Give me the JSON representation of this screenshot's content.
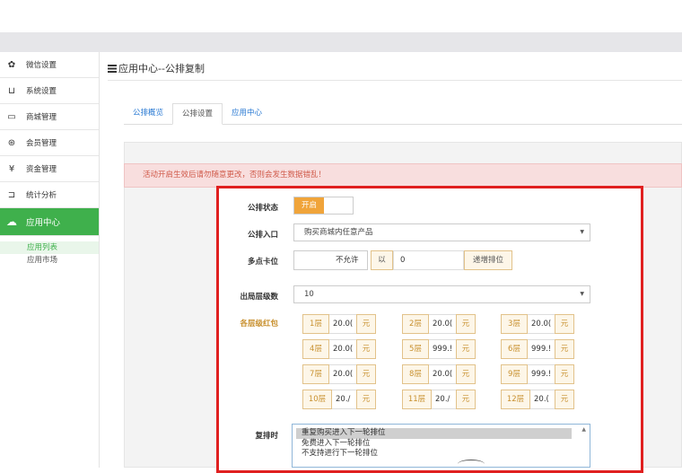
{
  "sidebar": {
    "items": [
      {
        "label": "微信设置",
        "icon": "gear-icon",
        "glyph": "✿"
      },
      {
        "label": "系统设置",
        "icon": "monitor-icon",
        "glyph": "⊔"
      },
      {
        "label": "商城管理",
        "icon": "store-icon",
        "glyph": "▭"
      },
      {
        "label": "会员管理",
        "icon": "member-icon",
        "glyph": "⊛"
      },
      {
        "label": "资金管理",
        "icon": "money-icon",
        "glyph": "¥"
      },
      {
        "label": "统计分析",
        "icon": "stats-icon",
        "glyph": "⊐"
      },
      {
        "label": "应用中心",
        "icon": "cloud-icon",
        "glyph": "☁"
      }
    ],
    "sub_items": [
      "应用列表",
      "应用市场"
    ]
  },
  "header": {
    "title": "应用中心--公排复制"
  },
  "tabs": [
    "公排概览",
    "公排设置",
    "应用中心"
  ],
  "warning": "活动开启生效后请勿随意更改，否则会发生数据错乱！",
  "form": {
    "status_label": "公排状态",
    "status_value": "开启",
    "entry_label": "公排入口",
    "entry_value": "购买商城内任意产品",
    "multi_label": "多点卡位",
    "multi_off": "不允许",
    "multi_by": "以",
    "multi_num": "0",
    "multi_suffix": "递增排位",
    "exit_label": "出局层级数",
    "exit_value": "10",
    "redpack_label": "各层级红包",
    "layers": [
      {
        "name": "1层",
        "value": "20.0(",
        "unit": "元"
      },
      {
        "name": "2层",
        "value": "20.0(",
        "unit": "元"
      },
      {
        "name": "3层",
        "value": "20.0(",
        "unit": "元"
      },
      {
        "name": "4层",
        "value": "20.0(",
        "unit": "元"
      },
      {
        "name": "5层",
        "value": "999.!",
        "unit": "元"
      },
      {
        "name": "6层",
        "value": "999.!",
        "unit": "元"
      },
      {
        "name": "7层",
        "value": "20.0(",
        "unit": "元"
      },
      {
        "name": "8层",
        "value": "20.0(",
        "unit": "元"
      },
      {
        "name": "9层",
        "value": "999.!",
        "unit": "元"
      },
      {
        "name": "10层",
        "value": "20./",
        "unit": "元"
      },
      {
        "name": "11层",
        "value": "20./",
        "unit": "元"
      },
      {
        "name": "12层",
        "value": "20.(",
        "unit": "元"
      }
    ],
    "repeat_label": "复排时",
    "repeat_options": [
      "重复购买进入下一轮排位",
      "免费进入下一轮排位",
      "不支持进行下一轮排位"
    ]
  },
  "colors": {
    "accent": "#3fb04c",
    "toggle": "#f0a43a",
    "warning_bg": "#f8dede",
    "highlight": "#e02020"
  }
}
